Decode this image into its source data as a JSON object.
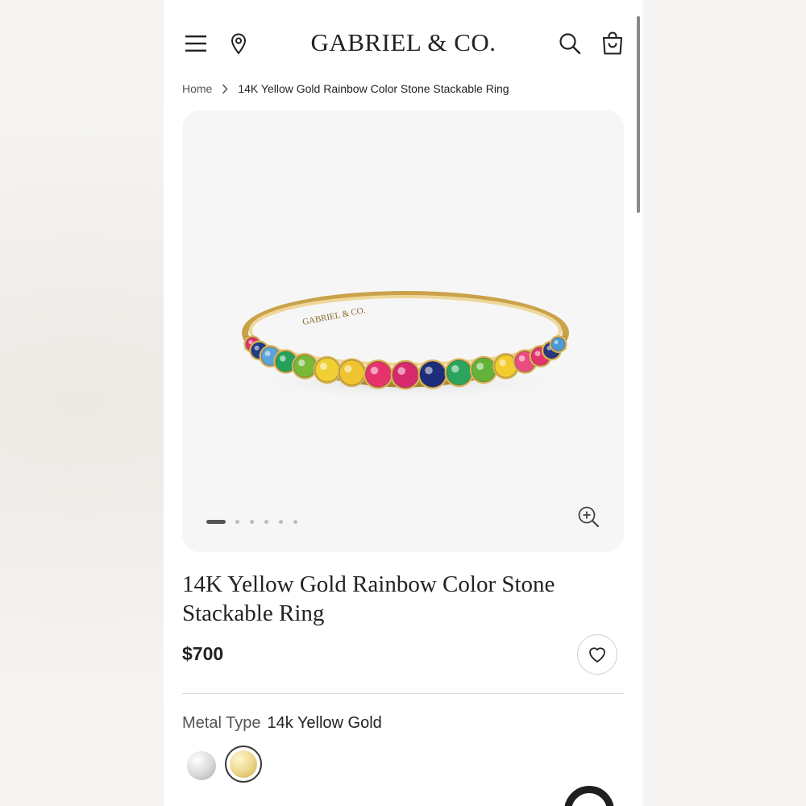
{
  "header": {
    "brand": "GABRIEL & CO.",
    "menu_icon": "hamburger-menu-icon",
    "location_icon": "map-pin-icon",
    "search_icon": "search-icon",
    "cart_icon": "shopping-bag-icon"
  },
  "breadcrumb": {
    "home": "Home",
    "current": "14K Yellow Gold Rainbow Color Stone Stackable Ring"
  },
  "gallery": {
    "image_engraving": "GABRIEL & CO.",
    "slide_count": 6,
    "active_slide": 1,
    "zoom_icon": "zoom-in-icon",
    "stone_colors": [
      "#e2336d",
      "#223a8a",
      "#5aa3d9",
      "#27a05b",
      "#7ab83a",
      "#f0d035",
      "#f0c330",
      "#e6336d",
      "#d52a6b",
      "#1f2e7a",
      "#2da45e",
      "#63b33b",
      "#f3cd2e",
      "#ea4c80",
      "#e2336d",
      "#27387f",
      "#4f98d6"
    ],
    "metal_color": "#d9b45a"
  },
  "product": {
    "title": "14K Yellow Gold Rainbow Color Stone Stackable Ring",
    "price": "$700",
    "wishlist_icon": "heart-icon"
  },
  "options": {
    "metal_label": "Metal Type",
    "metal_value": "14k Yellow Gold",
    "swatches": [
      {
        "name": "white-gold",
        "color": "#d4d4d4",
        "selected": false
      },
      {
        "name": "yellow-gold",
        "color": "#ecd689",
        "selected": true
      }
    ]
  }
}
